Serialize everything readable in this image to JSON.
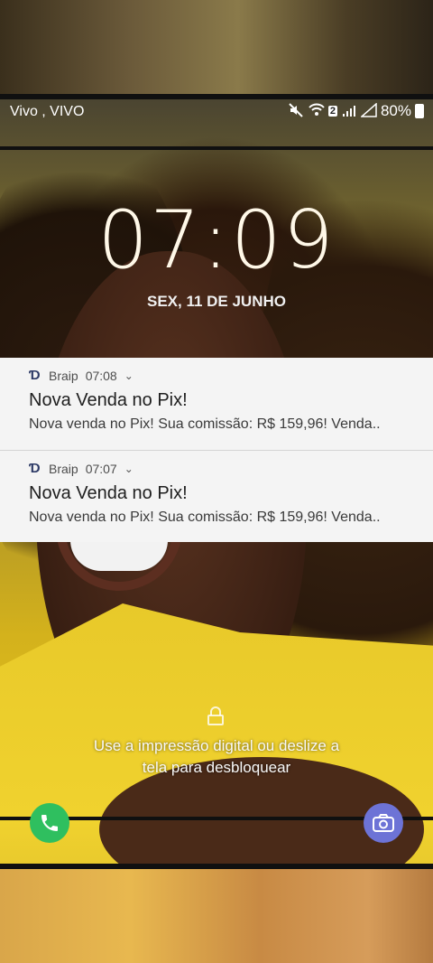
{
  "status_bar": {
    "carrier": "Vivo , VIVO",
    "sim_badge": "2",
    "battery": "80%"
  },
  "lockscreen": {
    "time": "07:09",
    "date": "SEX, 11 DE JUNHO",
    "unlock_hint_line1": "Use a impressão digital ou deslize a",
    "unlock_hint_line2": "tela para desbloquear"
  },
  "notifications": [
    {
      "app": "Braip",
      "time": "07:08",
      "title": "Nova Venda no Pix!",
      "body": "Nova venda no Pix! Sua comissão: R$ 159,96! Venda.."
    },
    {
      "app": "Braip",
      "time": "07:07",
      "title": "Nova Venda no Pix!",
      "body": "Nova venda no Pix! Sua comissão: R$ 159,96! Venda.."
    }
  ],
  "shortcuts": {
    "left_icon": "phone-icon",
    "right_icon": "camera-icon",
    "phone_color": "#2fbf5f",
    "camera_color": "#6d73d6"
  }
}
